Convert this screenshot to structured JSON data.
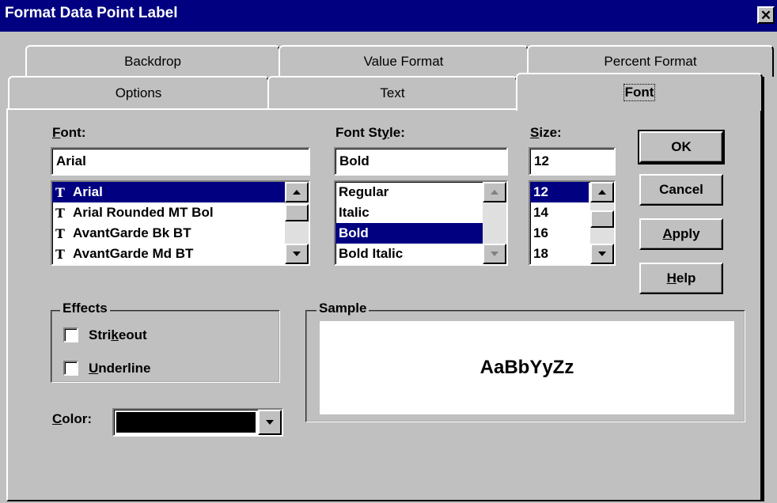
{
  "window": {
    "title": "Format Data Point Label",
    "close_glyph": "✕"
  },
  "tabs": {
    "back_row": [
      "Backdrop",
      "Value Format",
      "Percent Format"
    ],
    "front_row": [
      "Options",
      "Text",
      "Font"
    ],
    "active": "Font"
  },
  "font": {
    "label_accel": "F",
    "label_rest": "ont:",
    "value": "Arial",
    "items": [
      "Arial",
      "Arial Rounded MT Bol",
      "AvantGarde Bk BT",
      "AvantGarde Md BT"
    ],
    "selected": "Arial",
    "item_icon": "truetype-font-icon",
    "item_icon_glyph": "T"
  },
  "font_style": {
    "label_pre": "Font St",
    "label_accel": "y",
    "label_post": "le:",
    "value": "Bold",
    "items": [
      "Regular",
      "Italic",
      "Bold",
      "Bold Italic"
    ],
    "selected": "Bold"
  },
  "size": {
    "label_accel": "S",
    "label_rest": "ize:",
    "value": "12",
    "items": [
      "12",
      "14",
      "16",
      "18"
    ],
    "selected": "12"
  },
  "buttons": {
    "ok": "OK",
    "cancel": "Cancel",
    "apply_accel": "A",
    "apply_rest": "pply",
    "help_accel": "H",
    "help_rest": "elp"
  },
  "effects": {
    "title": "Effects",
    "strikeout_pre": "Stri",
    "strikeout_accel": "k",
    "strikeout_post": "eout",
    "strikeout_checked": false,
    "underline_accel": "U",
    "underline_rest": "nderline",
    "underline_checked": false
  },
  "color": {
    "label_accel": "C",
    "label_rest": "olor:",
    "value_hex": "#000000"
  },
  "sample": {
    "title": "Sample",
    "text": "AaBbYyZz"
  },
  "colors": {
    "titlebar": "#000080",
    "face": "#c0c0c0",
    "selection": "#000080"
  }
}
